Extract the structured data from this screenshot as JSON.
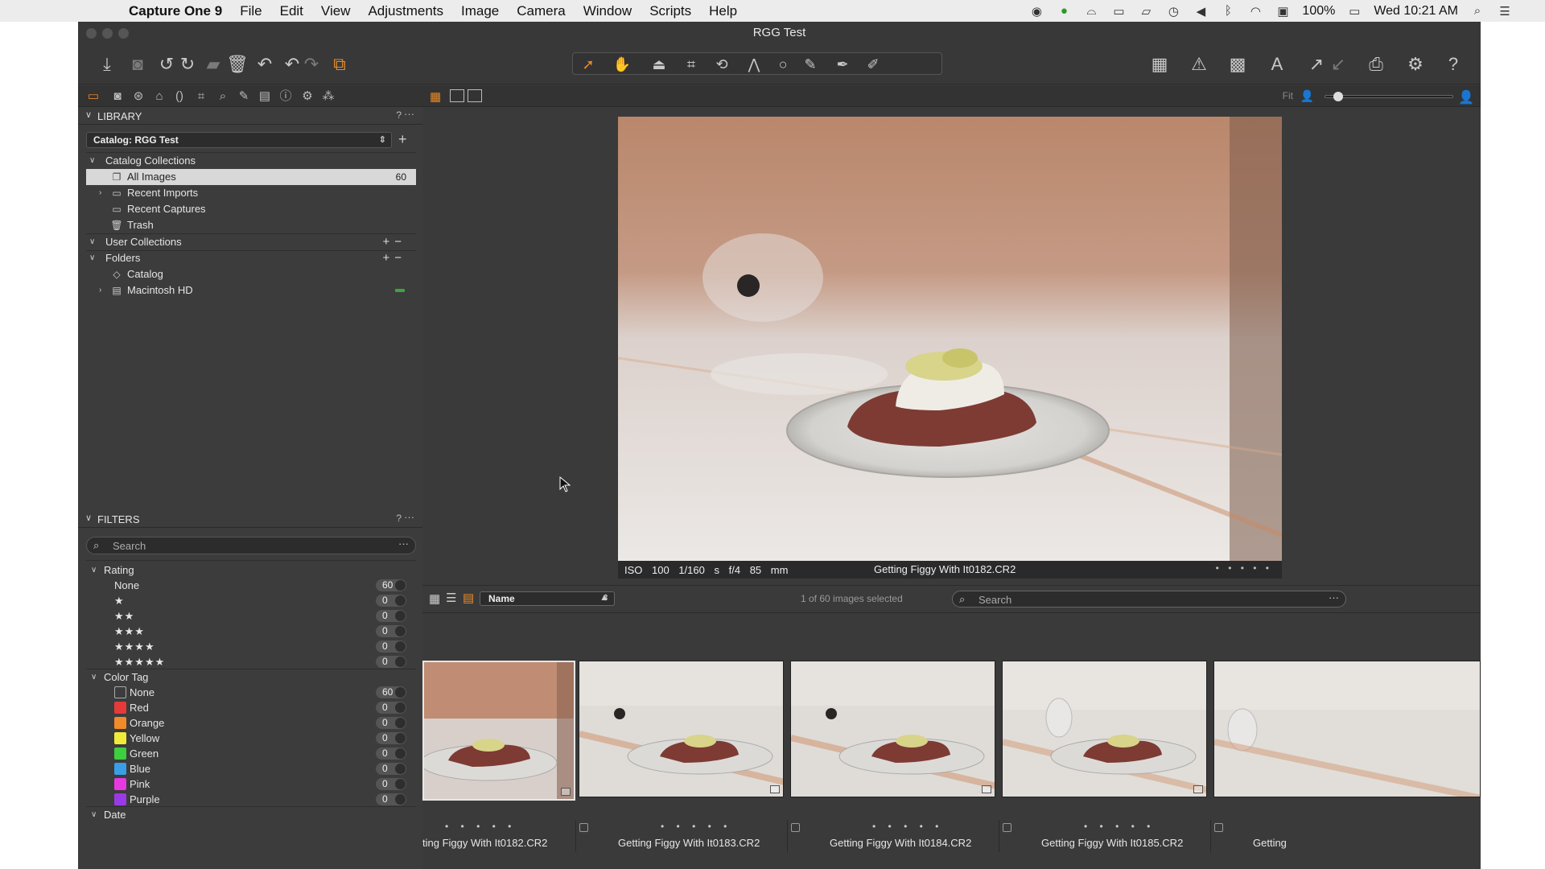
{
  "menubar": {
    "app_name": "Capture One 9",
    "items": [
      "File",
      "Edit",
      "View",
      "Adjustments",
      "Image",
      "Camera",
      "Window",
      "Scripts",
      "Help"
    ],
    "battery": "100%",
    "clock": "Wed 10:21 AM"
  },
  "window": {
    "title": "RGG Test"
  },
  "library": {
    "header": "LIBRARY",
    "help": "?",
    "more": "···",
    "catalog_select": "Catalog: RGG Test",
    "add": "+",
    "catalog_collections": "Catalog Collections",
    "all_images": "All Images",
    "all_images_count": "60",
    "recent_imports": "Recent Imports",
    "recent_captures": "Recent Captures",
    "trash": "Trash",
    "user_collections": "User Collections",
    "folders": "Folders",
    "catalog_folder": "Catalog",
    "macintosh_hd": "Macintosh HD",
    "plusminus": "+−"
  },
  "filters": {
    "header": "FILTERS",
    "help": "?",
    "more": "···",
    "search_placeholder": "Search",
    "search_more": "···",
    "rating_label": "Rating",
    "ratings": [
      {
        "label": "None",
        "count": "60"
      },
      {
        "label": "★",
        "count": "0"
      },
      {
        "label": "★★",
        "count": "0"
      },
      {
        "label": "★★★",
        "count": "0"
      },
      {
        "label": "★★★★",
        "count": "0"
      },
      {
        "label": "★★★★★",
        "count": "0"
      }
    ],
    "color_tag_label": "Color Tag",
    "color_tags": [
      {
        "label": "None",
        "count": "60",
        "color": "transparent"
      },
      {
        "label": "Red",
        "count": "0",
        "color": "#e63a3a"
      },
      {
        "label": "Orange",
        "count": "0",
        "color": "#f08a2a"
      },
      {
        "label": "Yellow",
        "count": "0",
        "color": "#f2ea3a"
      },
      {
        "label": "Green",
        "count": "0",
        "color": "#3ecf3e"
      },
      {
        "label": "Blue",
        "count": "0",
        "color": "#3a9ee6"
      },
      {
        "label": "Pink",
        "count": "0",
        "color": "#e63ae0"
      },
      {
        "label": "Purple",
        "count": "0",
        "color": "#9a3ae6"
      }
    ],
    "date_label": "Date"
  },
  "viewer": {
    "fit_label": "Fit",
    "caption": {
      "iso": "ISO 100",
      "shutter": "1/160 s",
      "aperture": "f/4",
      "focal": "85 mm",
      "filename": "Getting Figgy With It0182.CR2",
      "rating_dots": "• • • • •"
    }
  },
  "browser": {
    "sort_by": "Name",
    "sort_dir": "▲",
    "selection_status": "1 of 60 images selected",
    "search_placeholder": "Search",
    "search_more": "···",
    "thumbnails": [
      {
        "name": "ting Figgy With It0182.CR2",
        "dots": "• • • • •"
      },
      {
        "name": "Getting Figgy With It0183.CR2",
        "dots": "• • • • •"
      },
      {
        "name": "Getting Figgy With It0184.CR2",
        "dots": "• • • • •"
      },
      {
        "name": "Getting Figgy With It0185.CR2",
        "dots": "• • • • •"
      },
      {
        "name": "Getting",
        "dots": ""
      }
    ]
  },
  "colors": {
    "accent": "#e8892a",
    "panel_bg": "#3c3c3c",
    "selected_row": "#d8d8d8"
  }
}
